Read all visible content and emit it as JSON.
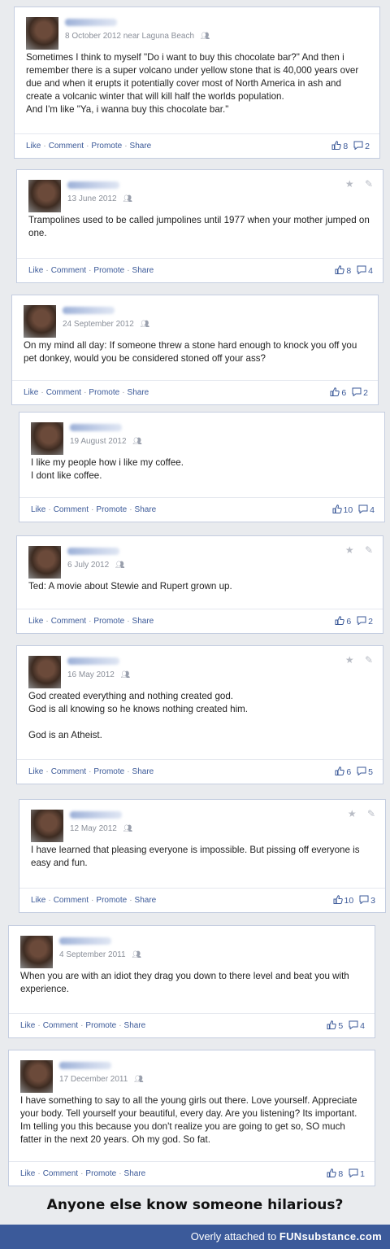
{
  "actions": {
    "like": "Like",
    "comment": "Comment",
    "promote": "Promote",
    "share": "Share"
  },
  "posts": [
    {
      "date": "8 October 2012 near Laguna Beach",
      "text": "Sometimes I think to myself \"Do i want to buy this chocolate bar?\" And then i remember there is a super volcano under yellow stone that is 40,000 years over due and when it erupts it potentially cover most of North America in ash and create a volcanic winter that will kill half the worlds population.\nAnd I'm like \"Ya, i wanna buy this chocolate bar.\"",
      "likes": "8",
      "comments": "2",
      "tools": false
    },
    {
      "date": "13 June 2012",
      "text": "Trampolines used to be called jumpolines until 1977 when your mother jumped on one.",
      "likes": "8",
      "comments": "4",
      "tools": true
    },
    {
      "date": "24 September 2012",
      "text": "On my mind all day: If someone threw a stone hard enough to knock you off you pet donkey, would you be considered stoned off your ass?",
      "likes": "6",
      "comments": "2",
      "tools": false
    },
    {
      "date": "19 August 2012",
      "text": "I like my people how i like my coffee.\nI dont like coffee.",
      "likes": "10",
      "comments": "4",
      "tools": false
    },
    {
      "date": "6 July 2012",
      "text": "Ted: A movie about Stewie and Rupert grown up.",
      "likes": "6",
      "comments": "2",
      "tools": true
    },
    {
      "date": "16 May 2012",
      "text": "God created everything and nothing created god.\nGod is all knowing so he knows nothing created him.\n\nGod is an Atheist.",
      "likes": "6",
      "comments": "5",
      "tools": true
    },
    {
      "date": "12 May 2012",
      "text": "I have learned that pleasing everyone is impossible. But pissing off everyone is easy and fun.",
      "likes": "10",
      "comments": "3",
      "tools": true
    },
    {
      "date": "4 September 2011",
      "text": "When you are with an idiot they drag you down to there level and beat you with experience.",
      "likes": "5",
      "comments": "4",
      "tools": false
    },
    {
      "date": "17 December 2011",
      "text": "I have something to say to all the young girls out there. Love yourself. Appreciate your body. Tell yourself your beautiful, every day. Are you listening? Its important. Im telling you this because you don't realize you are going to get so, SO much fatter in the next 20 years. Oh my god. So fat.",
      "likes": "8",
      "comments": "1",
      "tools": false
    }
  ],
  "caption": "Anyone else know someone hilarious?",
  "footer": {
    "attached_text": "Overly attached to ",
    "brand": "FUNsubstance.com"
  },
  "icons": {
    "like": "thumbs-up-icon",
    "comment": "comment-bubble-icon",
    "audience": "friends-icon",
    "star": "star-icon",
    "edit": "pencil-icon"
  }
}
